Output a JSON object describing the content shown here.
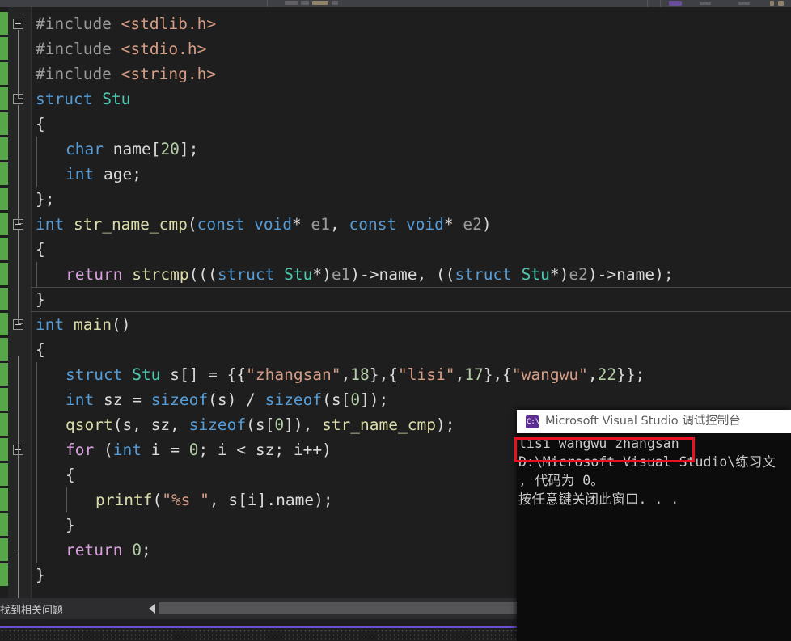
{
  "app": {
    "editor_theme": "dark",
    "accent_purple": "#6a4fd6",
    "change_margin_color": "#57a64a",
    "highlight_box_color": "#e81123"
  },
  "editor": {
    "lines": [
      {
        "indent": 0,
        "text": "#include <stdlib.h>",
        "fold": "open",
        "tokens": [
          {
            "t": "#include ",
            "c": "pp"
          },
          {
            "t": "<stdlib.h>",
            "c": "str"
          }
        ]
      },
      {
        "indent": 0,
        "text": "#include <stdio.h>",
        "fold": "none",
        "tokens": [
          {
            "t": "#include ",
            "c": "pp"
          },
          {
            "t": "<stdio.h>",
            "c": "str"
          }
        ]
      },
      {
        "indent": 0,
        "text": "#include <string.h>",
        "fold": "none",
        "tokens": [
          {
            "t": "#include ",
            "c": "pp"
          },
          {
            "t": "<string.h>",
            "c": "str"
          }
        ]
      },
      {
        "indent": 0,
        "text": "struct Stu",
        "fold": "open",
        "tokens": [
          {
            "t": "struct",
            "c": "kw"
          },
          {
            "t": " ",
            "c": "op"
          },
          {
            "t": "Stu",
            "c": "typ"
          }
        ]
      },
      {
        "indent": 0,
        "text": "{",
        "fold": "none",
        "tokens": [
          {
            "t": "{",
            "c": "op"
          }
        ]
      },
      {
        "indent": 1,
        "text": "char name[20];",
        "fold": "none",
        "tokens": [
          {
            "t": "char",
            "c": "kw"
          },
          {
            "t": " ",
            "c": "op"
          },
          {
            "t": "name",
            "c": "id"
          },
          {
            "t": "[",
            "c": "op"
          },
          {
            "t": "20",
            "c": "num"
          },
          {
            "t": "];",
            "c": "op"
          }
        ]
      },
      {
        "indent": 1,
        "text": "int age;",
        "fold": "none",
        "tokens": [
          {
            "t": "int",
            "c": "kw"
          },
          {
            "t": " ",
            "c": "op"
          },
          {
            "t": "age;",
            "c": "id"
          }
        ]
      },
      {
        "indent": 0,
        "text": "};",
        "fold": "none",
        "tokens": [
          {
            "t": "};",
            "c": "op"
          }
        ]
      },
      {
        "indent": 0,
        "text": "int str_name_cmp(const void* e1, const void* e2)",
        "fold": "open",
        "tokens": [
          {
            "t": "int",
            "c": "kw"
          },
          {
            "t": " ",
            "c": "op"
          },
          {
            "t": "str_name_cmp",
            "c": "fn"
          },
          {
            "t": "(",
            "c": "op"
          },
          {
            "t": "const",
            "c": "kw"
          },
          {
            "t": " ",
            "c": "op"
          },
          {
            "t": "void",
            "c": "kw"
          },
          {
            "t": "* ",
            "c": "op"
          },
          {
            "t": "e1",
            "c": "pa"
          },
          {
            "t": ", ",
            "c": "op"
          },
          {
            "t": "const",
            "c": "kw"
          },
          {
            "t": " ",
            "c": "op"
          },
          {
            "t": "void",
            "c": "kw"
          },
          {
            "t": "* ",
            "c": "op"
          },
          {
            "t": "e2",
            "c": "pa"
          },
          {
            "t": ")",
            "c": "op"
          }
        ]
      },
      {
        "indent": 0,
        "text": "{",
        "fold": "none",
        "tokens": [
          {
            "t": "{",
            "c": "op"
          }
        ]
      },
      {
        "indent": 1,
        "text": "return strcmp(((struct Stu*)e1)->name, ((struct Stu*)e2)->name);",
        "fold": "none",
        "tokens": [
          {
            "t": "return",
            "c": "ctl"
          },
          {
            "t": " ",
            "c": "op"
          },
          {
            "t": "strcmp",
            "c": "fn"
          },
          {
            "t": "(((",
            "c": "op"
          },
          {
            "t": "struct",
            "c": "kw"
          },
          {
            "t": " ",
            "c": "op"
          },
          {
            "t": "Stu",
            "c": "typ"
          },
          {
            "t": "*)",
            "c": "op"
          },
          {
            "t": "e1",
            "c": "pa"
          },
          {
            "t": ")->",
            "c": "op"
          },
          {
            "t": "name",
            "c": "id"
          },
          {
            "t": ", ((",
            "c": "op"
          },
          {
            "t": "struct",
            "c": "kw"
          },
          {
            "t": " ",
            "c": "op"
          },
          {
            "t": "Stu",
            "c": "typ"
          },
          {
            "t": "*)",
            "c": "op"
          },
          {
            "t": "e2",
            "c": "pa"
          },
          {
            "t": ")->",
            "c": "op"
          },
          {
            "t": "name",
            "c": "id"
          },
          {
            "t": ");",
            "c": "op"
          }
        ]
      },
      {
        "indent": 0,
        "text": "}",
        "fold": "none",
        "current": true,
        "tokens": [
          {
            "t": "}",
            "c": "op"
          }
        ]
      },
      {
        "indent": 0,
        "text": "int main()",
        "fold": "open",
        "tokens": [
          {
            "t": "int",
            "c": "kw"
          },
          {
            "t": " ",
            "c": "op"
          },
          {
            "t": "main",
            "c": "fn"
          },
          {
            "t": "()",
            "c": "op"
          }
        ]
      },
      {
        "indent": 0,
        "text": "{",
        "fold": "none",
        "tokens": [
          {
            "t": "{",
            "c": "op"
          }
        ]
      },
      {
        "indent": 1,
        "text": "struct Stu s[] = {{\"zhangsan\",18},{\"lisi\",17},{\"wangwu\",22}};",
        "fold": "none",
        "tokens": [
          {
            "t": "struct",
            "c": "kw"
          },
          {
            "t": " ",
            "c": "op"
          },
          {
            "t": "Stu",
            "c": "typ"
          },
          {
            "t": " ",
            "c": "op"
          },
          {
            "t": "s",
            "c": "id"
          },
          {
            "t": "[] = {{",
            "c": "op"
          },
          {
            "t": "\"zhangsan\"",
            "c": "str"
          },
          {
            "t": ",",
            "c": "op"
          },
          {
            "t": "18",
            "c": "num"
          },
          {
            "t": "},{",
            "c": "op"
          },
          {
            "t": "\"lisi\"",
            "c": "str"
          },
          {
            "t": ",",
            "c": "op"
          },
          {
            "t": "17",
            "c": "num"
          },
          {
            "t": "},{",
            "c": "op"
          },
          {
            "t": "\"wangwu\"",
            "c": "str"
          },
          {
            "t": ",",
            "c": "op"
          },
          {
            "t": "22",
            "c": "num"
          },
          {
            "t": "}};",
            "c": "op"
          }
        ]
      },
      {
        "indent": 1,
        "text": "int sz = sizeof(s) / sizeof(s[0]);",
        "fold": "none",
        "tokens": [
          {
            "t": "int",
            "c": "kw"
          },
          {
            "t": " ",
            "c": "op"
          },
          {
            "t": "sz = ",
            "c": "id"
          },
          {
            "t": "sizeof",
            "c": "kw"
          },
          {
            "t": "(",
            "c": "op"
          },
          {
            "t": "s",
            "c": "id"
          },
          {
            "t": ") / ",
            "c": "op"
          },
          {
            "t": "sizeof",
            "c": "kw"
          },
          {
            "t": "(",
            "c": "op"
          },
          {
            "t": "s",
            "c": "id"
          },
          {
            "t": "[",
            "c": "op"
          },
          {
            "t": "0",
            "c": "num"
          },
          {
            "t": "]);",
            "c": "op"
          }
        ]
      },
      {
        "indent": 1,
        "text": "qsort(s, sz, sizeof(s[0]), str_name_cmp);",
        "fold": "none",
        "tokens": [
          {
            "t": "qsort",
            "c": "fn"
          },
          {
            "t": "(",
            "c": "op"
          },
          {
            "t": "s",
            "c": "id"
          },
          {
            "t": ", ",
            "c": "op"
          },
          {
            "t": "sz",
            "c": "id"
          },
          {
            "t": ", ",
            "c": "op"
          },
          {
            "t": "sizeof",
            "c": "kw"
          },
          {
            "t": "(",
            "c": "op"
          },
          {
            "t": "s",
            "c": "id"
          },
          {
            "t": "[",
            "c": "op"
          },
          {
            "t": "0",
            "c": "num"
          },
          {
            "t": "]), ",
            "c": "op"
          },
          {
            "t": "str_name_cmp",
            "c": "fn"
          },
          {
            "t": ");",
            "c": "op"
          }
        ]
      },
      {
        "indent": 1,
        "text": "for (int i = 0; i < sz; i++)",
        "fold": "open",
        "tokens": [
          {
            "t": "for",
            "c": "ctl"
          },
          {
            "t": " (",
            "c": "op"
          },
          {
            "t": "int",
            "c": "kw"
          },
          {
            "t": " ",
            "c": "op"
          },
          {
            "t": "i",
            "c": "id"
          },
          {
            "t": " = ",
            "c": "op"
          },
          {
            "t": "0",
            "c": "num"
          },
          {
            "t": "; ",
            "c": "op"
          },
          {
            "t": "i",
            "c": "id"
          },
          {
            "t": " < ",
            "c": "op"
          },
          {
            "t": "sz",
            "c": "id"
          },
          {
            "t": "; ",
            "c": "op"
          },
          {
            "t": "i",
            "c": "id"
          },
          {
            "t": "++)",
            "c": "op"
          }
        ]
      },
      {
        "indent": 1,
        "text": "{",
        "fold": "none",
        "tokens": [
          {
            "t": "{",
            "c": "op"
          }
        ]
      },
      {
        "indent": 2,
        "text": "printf(\"%s \", s[i].name);",
        "fold": "none",
        "tokens": [
          {
            "t": "printf",
            "c": "fn"
          },
          {
            "t": "(",
            "c": "op"
          },
          {
            "t": "\"%s \"",
            "c": "str"
          },
          {
            "t": ", ",
            "c": "op"
          },
          {
            "t": "s",
            "c": "id"
          },
          {
            "t": "[",
            "c": "op"
          },
          {
            "t": "i",
            "c": "id"
          },
          {
            "t": "].",
            "c": "op"
          },
          {
            "t": "name",
            "c": "id"
          },
          {
            "t": ");",
            "c": "op"
          }
        ]
      },
      {
        "indent": 1,
        "text": "}",
        "fold": "none",
        "tokens": [
          {
            "t": "}",
            "c": "op"
          }
        ]
      },
      {
        "indent": 1,
        "text": "return 0;",
        "fold": "none",
        "tokens": [
          {
            "t": "return",
            "c": "ctl"
          },
          {
            "t": " ",
            "c": "op"
          },
          {
            "t": "0",
            "c": "num"
          },
          {
            "t": ";",
            "c": "op"
          }
        ]
      },
      {
        "indent": 0,
        "text": "}",
        "fold": "none",
        "tokens": [
          {
            "t": "}",
            "c": "op"
          }
        ]
      }
    ]
  },
  "status_bar": {
    "message": "找到相关问题",
    "scroll_left_arrow": "left-arrow-icon"
  },
  "console": {
    "icon": "command-prompt-icon",
    "icon_glyph": "C:\\",
    "title": "Microsoft Visual Studio 调试控制台",
    "output_lines": [
      "lisi wangwu zhangsan",
      "D:\\Microsoft Visual Studio\\练习文",
      ", 代码为 0。",
      "按任意键关闭此窗口. . ."
    ],
    "highlighted_line_index": 0
  }
}
